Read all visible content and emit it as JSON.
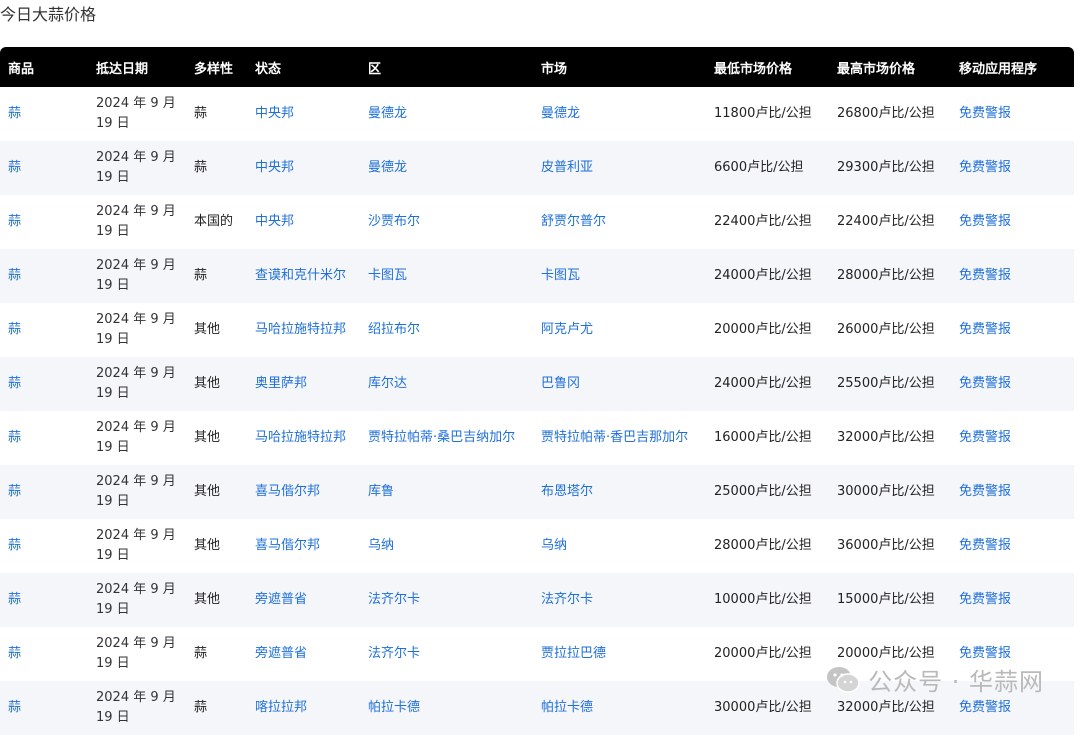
{
  "page": {
    "title": "今日大蒜价格"
  },
  "table": {
    "headers": [
      "商品",
      "抵达日期",
      "多样性",
      "状态",
      "区",
      "市场",
      "最低市场价格",
      "最高市场价格",
      "移动应用程序"
    ],
    "rows": [
      {
        "commodity": "蒜",
        "date": "2024 年 9 月 19 日",
        "variety": "蒜",
        "state": "中央邦",
        "district": "曼德龙",
        "market": "曼德龙",
        "min_price": "11800卢比/公担",
        "max_price": "26800卢比/公担",
        "app": "免费警报"
      },
      {
        "commodity": "蒜",
        "date": "2024 年 9 月 19 日",
        "variety": "蒜",
        "state": "中央邦",
        "district": "曼德龙",
        "market": "皮普利亚",
        "min_price": "6600卢比/公担",
        "max_price": "29300卢比/公担",
        "app": "免费警报"
      },
      {
        "commodity": "蒜",
        "date": "2024 年 9 月 19 日",
        "variety": "本国的",
        "state": "中央邦",
        "district": "沙贾布尔",
        "market": "舒贾尔普尔",
        "min_price": "22400卢比/公担",
        "max_price": "22400卢比/公担",
        "app": "免费警报"
      },
      {
        "commodity": "蒜",
        "date": "2024 年 9 月 19 日",
        "variety": "蒜",
        "state": "查谟和克什米尔",
        "district": "卡图瓦",
        "market": "卡图瓦",
        "min_price": "24000卢比/公担",
        "max_price": "28000卢比/公担",
        "app": "免费警报"
      },
      {
        "commodity": "蒜",
        "date": "2024 年 9 月 19 日",
        "variety": "其他",
        "state": "马哈拉施特拉邦",
        "district": "绍拉布尔",
        "market": "阿克卢尤",
        "min_price": "20000卢比/公担",
        "max_price": "26000卢比/公担",
        "app": "免费警报"
      },
      {
        "commodity": "蒜",
        "date": "2024 年 9 月 19 日",
        "variety": "其他",
        "state": "奥里萨邦",
        "district": "库尔达",
        "market": "巴鲁冈",
        "min_price": "24000卢比/公担",
        "max_price": "25500卢比/公担",
        "app": "免费警报"
      },
      {
        "commodity": "蒜",
        "date": "2024 年 9 月 19 日",
        "variety": "其他",
        "state": "马哈拉施特拉邦",
        "district": "贾特拉帕蒂·桑巴吉纳加尔",
        "market": "贾特拉帕蒂·香巴吉那加尔",
        "min_price": "16000卢比/公担",
        "max_price": "32000卢比/公担",
        "app": "免费警报"
      },
      {
        "commodity": "蒜",
        "date": "2024 年 9 月 19 日",
        "variety": "其他",
        "state": "喜马偕尔邦",
        "district": "库鲁",
        "market": "布恩塔尔",
        "min_price": "25000卢比/公担",
        "max_price": "30000卢比/公担",
        "app": "免费警报"
      },
      {
        "commodity": "蒜",
        "date": "2024 年 9 月 19 日",
        "variety": "其他",
        "state": "喜马偕尔邦",
        "district": "乌纳",
        "market": "乌纳",
        "min_price": "28000卢比/公担",
        "max_price": "36000卢比/公担",
        "app": "免费警报"
      },
      {
        "commodity": "蒜",
        "date": "2024 年 9 月 19 日",
        "variety": "其他",
        "state": "旁遮普省",
        "district": "法齐尔卡",
        "market": "法齐尔卡",
        "min_price": "10000卢比/公担",
        "max_price": "15000卢比/公担",
        "app": "免费警报"
      },
      {
        "commodity": "蒜",
        "date": "2024 年 9 月 19 日",
        "variety": "蒜",
        "state": "旁遮普省",
        "district": "法齐尔卡",
        "market": "贾拉拉巴德",
        "min_price": "20000卢比/公担",
        "max_price": "20000卢比/公担",
        "app": "免费警报"
      },
      {
        "commodity": "蒜",
        "date": "2024 年 9 月 19 日",
        "variety": "蒜",
        "state": "喀拉拉邦",
        "district": "帕拉卡德",
        "market": "帕拉卡德",
        "min_price": "30000卢比/公担",
        "max_price": "32000卢比/公担",
        "app": "免费警报"
      }
    ]
  },
  "watermark": {
    "text": "公众号 · 华蒜网",
    "icon": "wechat-icon"
  }
}
